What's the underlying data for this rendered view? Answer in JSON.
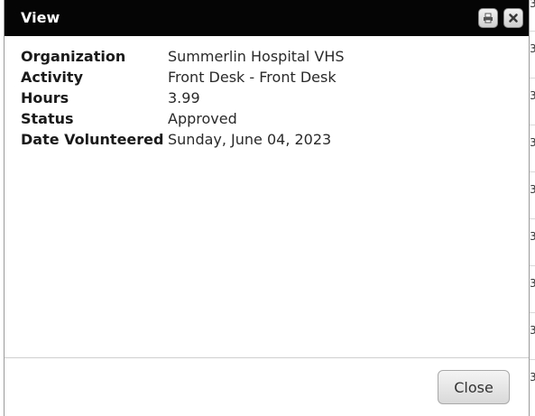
{
  "dialog": {
    "title": "View",
    "close_button_label": "Close"
  },
  "details": [
    {
      "label": "Organization",
      "value": "Summerlin Hospital VHS"
    },
    {
      "label": "Activity",
      "value": "Front Desk - Front Desk"
    },
    {
      "label": "Hours",
      "value": "3.99"
    },
    {
      "label": "Status",
      "value": "Approved"
    },
    {
      "label": "Date Volunteered",
      "value": "Sunday, June 04, 2023"
    }
  ],
  "titlebar_icons": [
    "print-icon",
    "close-icon"
  ],
  "background": {
    "row_glyphs": [
      "3",
      "3",
      "3",
      "3",
      "3",
      "3",
      "3",
      "3",
      "3"
    ]
  },
  "colors": {
    "titlebar": "#050505",
    "title_text": "#ffffff",
    "button_border": "#a9a9a9"
  }
}
